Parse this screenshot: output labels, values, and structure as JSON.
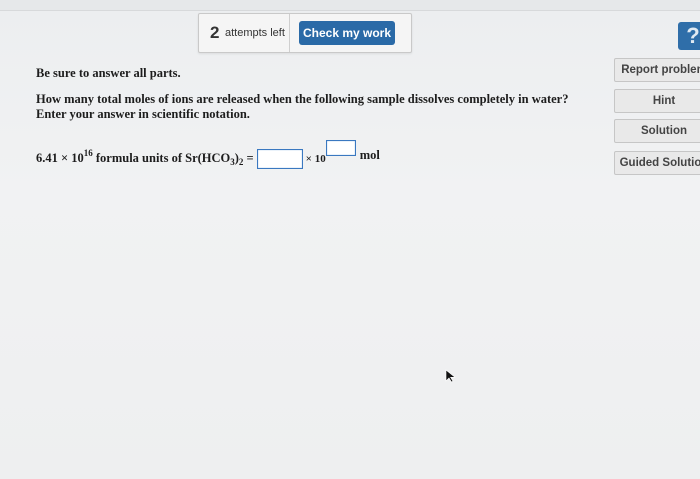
{
  "toolbar": {
    "attempts_count": "2",
    "attempts_label": "attempts left",
    "check_label": "Check my work"
  },
  "help_icon": "question-mark-icon",
  "side_buttons": {
    "report": "Report problem",
    "hint": "Hint",
    "solution": "Solution",
    "guided": "Guided Solution"
  },
  "question": {
    "instruction": "Be sure to answer all parts.",
    "prompt_line1": "How many total moles of ions are released when the following sample dissolves completely in water?",
    "prompt_line2": "Enter your answer in scientific notation.",
    "coefficient": "6.41 × 10",
    "exponent": "16",
    "formula_text": "formula units of Sr(HCO",
    "subscript_3": "3",
    "paren": ")",
    "subscript_2": "2",
    "equals": "=",
    "times_ten": "× 10",
    "unit": "mol",
    "coefficient_input": "",
    "exponent_input": ""
  },
  "colors": {
    "primary": "#2a6aa7",
    "input_border": "#3a78c0"
  }
}
